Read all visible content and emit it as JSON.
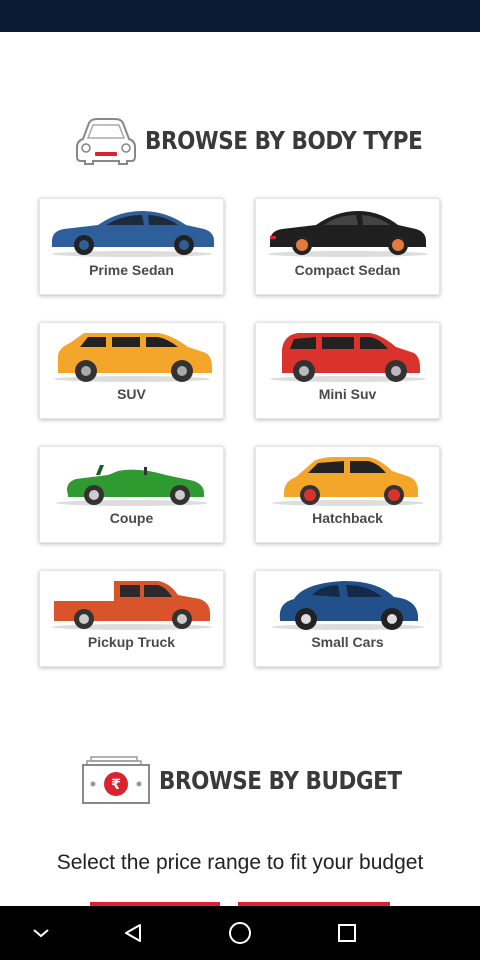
{
  "sections": {
    "body_type": {
      "title": "BROWSE BY BODY TYPE",
      "icon": "car-front-icon"
    },
    "budget": {
      "title": "BROWSE BY BUDGET",
      "icon": "rupee-note-icon",
      "hint": "Select the price range to fit your budget"
    }
  },
  "body_types": [
    {
      "label": "Prime Sedan",
      "icon": "sedan-car-icon",
      "color": "#2f5f9a"
    },
    {
      "label": "Compact Sedan",
      "icon": "sedan-car-icon",
      "color": "#1f1f1f"
    },
    {
      "label": "SUV",
      "icon": "suv-car-icon",
      "color": "#f3a629"
    },
    {
      "label": "Mini Suv",
      "icon": "hatchback-car-icon",
      "color": "#d9332b"
    },
    {
      "label": "Coupe",
      "icon": "convertible-car-icon",
      "color": "#2f9a2f"
    },
    {
      "label": "Hatchback",
      "icon": "hatchback-car-icon",
      "color": "#f3a629"
    },
    {
      "label": "Pickup Truck",
      "icon": "pickup-truck-icon",
      "color": "#d9532b"
    },
    {
      "label": "Small Cars",
      "icon": "beetle-car-icon",
      "color": "#22508a"
    }
  ],
  "colors": {
    "status_bar": "#0c1a33",
    "budget_accent": "#d9232e"
  },
  "nav": {
    "back": "back-icon",
    "home": "home-icon",
    "recents": "recents-icon",
    "collapse": "chevron-down-icon"
  }
}
